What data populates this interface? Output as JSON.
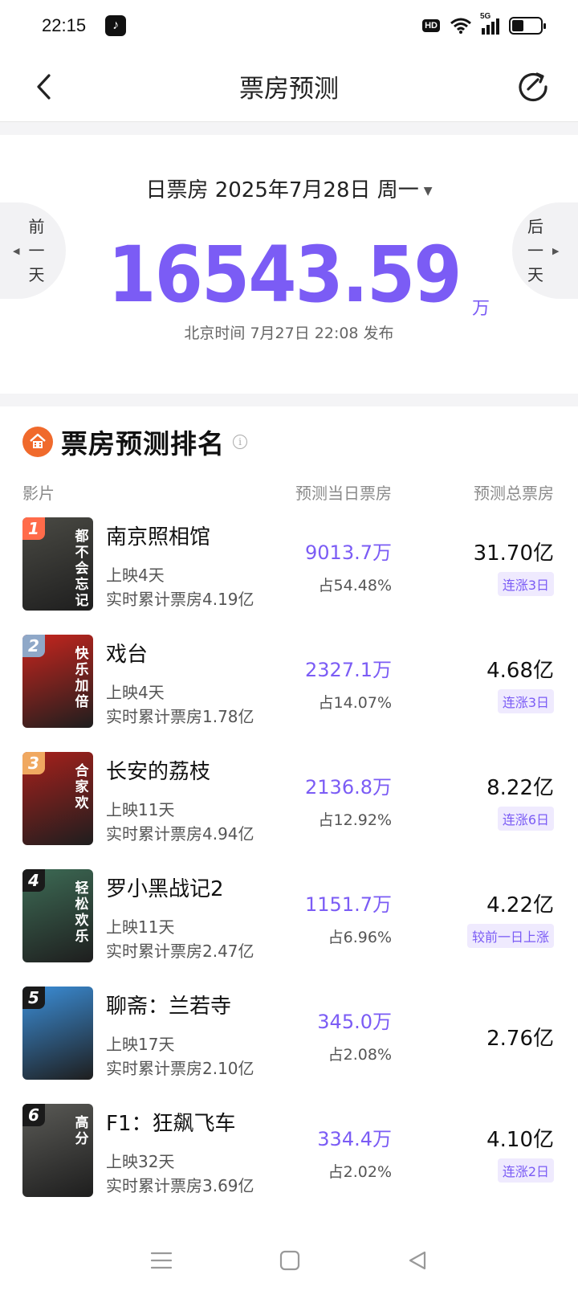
{
  "status_bar": {
    "time": "22:15",
    "app_icon": "tiktok-icon",
    "hd_label": "HD",
    "network_label": "5G",
    "battery_level": 0.4
  },
  "header": {
    "title": "票房预测",
    "back_icon": "chevron-left-icon",
    "refresh_icon": "refresh-icon"
  },
  "summary": {
    "date_label": "日票房 2025年7月28日 周一",
    "total_value": "16543.59",
    "unit": "万",
    "publish_time": "北京时间 7月27日 22:08 发布",
    "prev_day": [
      "前",
      "一",
      "天"
    ],
    "next_day": [
      "后",
      "一",
      "天"
    ]
  },
  "ranking": {
    "title": "票房预测排名",
    "columns": {
      "film": "影片",
      "daily": "预测当日票房",
      "total": "预测总票房"
    },
    "movies": [
      {
        "rank": "1",
        "name": "南京照相馆",
        "days": "上映4天",
        "cumulative": "实时累计票房4.19亿",
        "daily": "9013.7万",
        "share": "占54.48%",
        "total": "31.70亿",
        "badge": "连涨3日",
        "rank_color": "#ff6b4a",
        "poster_color": "#4a4a44",
        "poster_text": "都不会忘记"
      },
      {
        "rank": "2",
        "name": "戏台",
        "days": "上映4天",
        "cumulative": "实时累计票房1.78亿",
        "daily": "2327.1万",
        "share": "占14.07%",
        "total": "4.68亿",
        "badge": "连涨3日",
        "rank_color": "#8fa8c8",
        "poster_color": "#c8251e",
        "poster_text": "快乐加倍"
      },
      {
        "rank": "3",
        "name": "长安的荔枝",
        "days": "上映11天",
        "cumulative": "实时累计票房4.94亿",
        "daily": "2136.8万",
        "share": "占12.92%",
        "total": "8.22亿",
        "badge": "连涨6日",
        "rank_color": "#f0a860",
        "poster_color": "#a8201c",
        "poster_text": "合家欢"
      },
      {
        "rank": "4",
        "name": "罗小黑战记2",
        "days": "上映11天",
        "cumulative": "实时累计票房2.47亿",
        "daily": "1151.7万",
        "share": "占6.96%",
        "total": "4.22亿",
        "badge": "较前一日上涨",
        "rank_color": "#1a1a1a",
        "poster_color": "#3d6b55",
        "poster_text": "轻松欢乐"
      },
      {
        "rank": "5",
        "name": "聊斋：兰若寺",
        "days": "上映17天",
        "cumulative": "实时累计票房2.10亿",
        "daily": "345.0万",
        "share": "占2.08%",
        "total": "2.76亿",
        "badge": "",
        "rank_color": "#1a1a1a",
        "poster_color": "#3b8ed8",
        "poster_text": ""
      },
      {
        "rank": "6",
        "name": "F1：狂飙飞车",
        "days": "上映32天",
        "cumulative": "实时累计票房3.69亿",
        "daily": "334.4万",
        "share": "占2.02%",
        "total": "4.10亿",
        "badge": "连涨2日",
        "rank_color": "#1a1a1a",
        "poster_color": "#5a5a56",
        "poster_text": "高分"
      }
    ]
  },
  "bottom_nav": [
    "menu-icon",
    "home-icon",
    "back-icon"
  ]
}
